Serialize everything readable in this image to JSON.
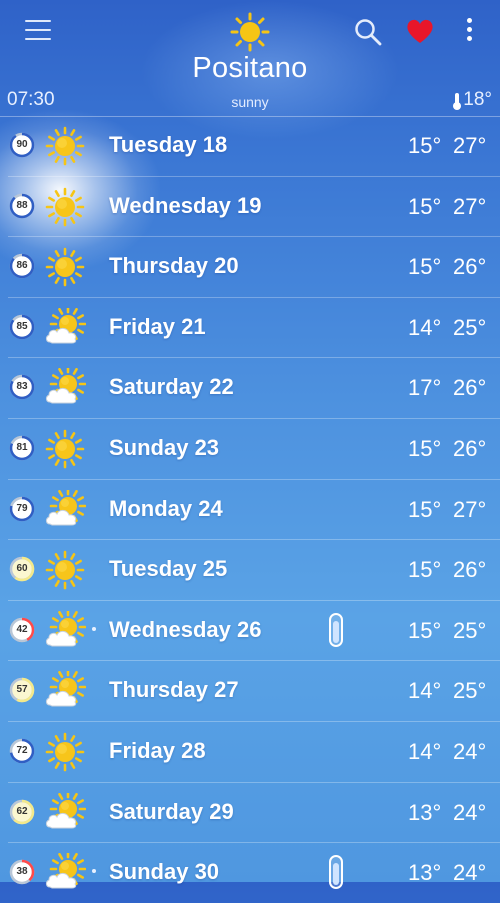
{
  "header": {
    "city": "Positano",
    "time": "07:30",
    "condition": "sunny",
    "current_temp": "18°",
    "icons": {
      "menu": "menu-icon",
      "weather": "sun-icon",
      "search": "search-icon",
      "favorite": "heart-icon",
      "more": "more-vertical-icon"
    }
  },
  "colors": {
    "heart": "#e8162a",
    "sun": "#f6c515",
    "badge_high": "#ffffff",
    "badge_mid": "#f3e98a",
    "badge_low": "#ff4a4a"
  },
  "days": [
    {
      "label": "Tuesday 18",
      "lo": "15°",
      "hi": "27°",
      "index": "90",
      "icon": "sun",
      "rain": false
    },
    {
      "label": "Wednesday 19",
      "lo": "15°",
      "hi": "27°",
      "index": "88",
      "icon": "sun",
      "rain": false
    },
    {
      "label": "Thursday 20",
      "lo": "15°",
      "hi": "26°",
      "index": "86",
      "icon": "sun",
      "rain": false
    },
    {
      "label": "Friday 21",
      "lo": "14°",
      "hi": "25°",
      "index": "85",
      "icon": "sun-cloud",
      "rain": false
    },
    {
      "label": "Saturday 22",
      "lo": "17°",
      "hi": "26°",
      "index": "83",
      "icon": "sun-cloud",
      "rain": false
    },
    {
      "label": "Sunday 23",
      "lo": "15°",
      "hi": "26°",
      "index": "81",
      "icon": "sun",
      "rain": false
    },
    {
      "label": "Monday 24",
      "lo": "15°",
      "hi": "27°",
      "index": "79",
      "icon": "sun-cloud",
      "rain": false
    },
    {
      "label": "Tuesday 25",
      "lo": "15°",
      "hi": "26°",
      "index": "60",
      "icon": "sun",
      "rain": false
    },
    {
      "label": "Wednesday 26",
      "lo": "15°",
      "hi": "25°",
      "index": "42",
      "icon": "sun-cloud",
      "rain": true
    },
    {
      "label": "Thursday 27",
      "lo": "14°",
      "hi": "25°",
      "index": "57",
      "icon": "sun-cloud",
      "rain": false
    },
    {
      "label": "Friday 28",
      "lo": "14°",
      "hi": "24°",
      "index": "72",
      "icon": "sun",
      "rain": false
    },
    {
      "label": "Saturday 29",
      "lo": "13°",
      "hi": "24°",
      "index": "62",
      "icon": "sun-cloud",
      "rain": false
    },
    {
      "label": "Sunday 30",
      "lo": "13°",
      "hi": "24°",
      "index": "38",
      "icon": "sun-cloud",
      "rain": true
    }
  ]
}
